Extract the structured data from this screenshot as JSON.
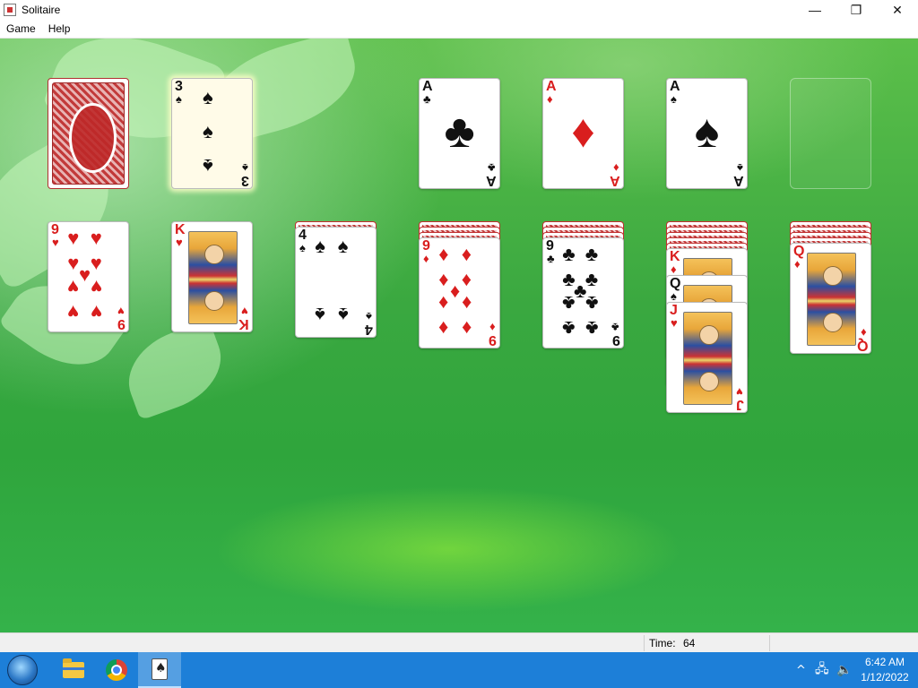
{
  "window": {
    "title": "Solitaire",
    "controls": {
      "minimize": "—",
      "maximize": "❐",
      "close": "✕"
    }
  },
  "menu": [
    "Game",
    "Help"
  ],
  "status": {
    "time_label": "Time:",
    "time_value": "64"
  },
  "board": {
    "stock": {
      "face_down": true
    },
    "waste": {
      "rank": "3",
      "suit": "♠",
      "color": "black",
      "selected": true
    },
    "foundations": [
      {
        "rank": "A",
        "suit": "♣",
        "color": "black"
      },
      {
        "rank": "A",
        "suit": "♦",
        "color": "red"
      },
      {
        "rank": "A",
        "suit": "♠",
        "color": "black"
      },
      {
        "empty": true
      }
    ],
    "tableau": [
      {
        "hidden": 0,
        "cards": [
          {
            "rank": "9",
            "suit": "♥",
            "color": "red"
          }
        ]
      },
      {
        "hidden": 0,
        "cards": [
          {
            "rank": "K",
            "suit": "♥",
            "color": "red"
          }
        ]
      },
      {
        "hidden": 1,
        "cards": [
          {
            "rank": "4",
            "suit": "♠",
            "color": "black"
          }
        ]
      },
      {
        "hidden": 3,
        "cards": [
          {
            "rank": "9",
            "suit": "♦",
            "color": "red"
          }
        ]
      },
      {
        "hidden": 3,
        "cards": [
          {
            "rank": "9",
            "suit": "♣",
            "color": "black"
          }
        ]
      },
      {
        "hidden": 5,
        "cards": [
          {
            "rank": "K",
            "suit": "♦",
            "color": "red"
          },
          {
            "rank": "Q",
            "suit": "♠",
            "color": "black"
          },
          {
            "rank": "J",
            "suit": "♥",
            "color": "red"
          }
        ]
      },
      {
        "hidden": 4,
        "cards": [
          {
            "rank": "Q",
            "suit": "♦",
            "color": "red"
          }
        ]
      }
    ]
  },
  "taskbar": {
    "apps": [
      "file-explorer",
      "chrome",
      "solitaire"
    ],
    "tray": {
      "chevron": "^",
      "network": "🖧",
      "volume": "🔈"
    },
    "clock": {
      "time": "6:42 AM",
      "date": "1/12/2022"
    }
  }
}
